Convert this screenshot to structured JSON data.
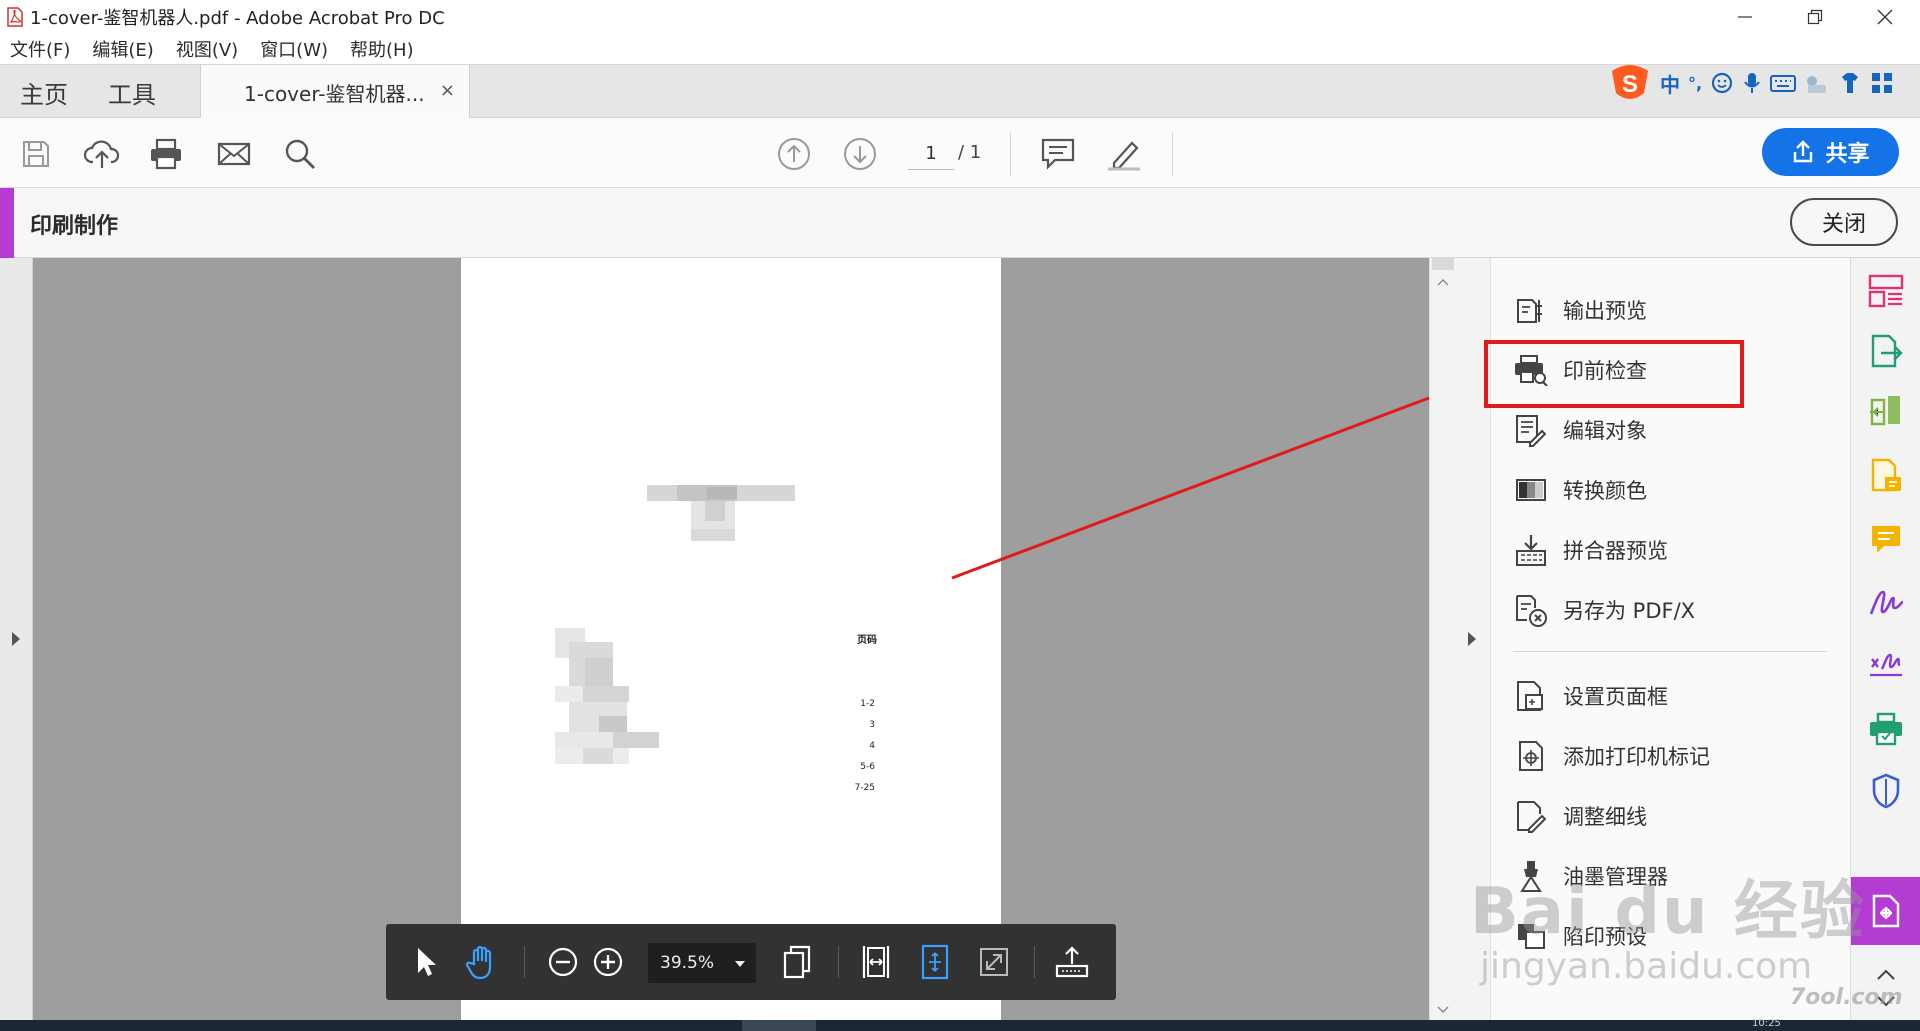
{
  "window": {
    "title": "1-cover-鉴智机器人.pdf - Adobe Acrobat Pro DC"
  },
  "menubar": {
    "items": [
      "文件(F)",
      "编辑(E)",
      "视图(V)",
      "窗口(W)",
      "帮助(H)"
    ]
  },
  "tabs": {
    "home": "主页",
    "tools": "工具",
    "document": "1-cover-鉴智机器...",
    "close_glyph": "×"
  },
  "ime": {
    "lang": "中",
    "punct": "°,"
  },
  "toolbar": {
    "page_current": "1",
    "page_total": "/ 1",
    "share_label": "共享"
  },
  "tool_panel_header": {
    "title": "印刷制作",
    "close_label": "关闭"
  },
  "document_page": {
    "toc_title": "页码",
    "toc_entries": [
      "1-2",
      "3",
      "4",
      "5-6",
      "7-25"
    ]
  },
  "float_toolbar": {
    "zoom": "39.5%"
  },
  "print_tools": {
    "group1": [
      {
        "label": "输出预览",
        "icon": "output-preview-icon"
      },
      {
        "label": "印前检查",
        "icon": "preflight-icon"
      },
      {
        "label": "编辑对象",
        "icon": "edit-object-icon"
      },
      {
        "label": "转换颜色",
        "icon": "convert-colors-icon"
      },
      {
        "label": "拼合器预览",
        "icon": "flattener-preview-icon"
      },
      {
        "label": "另存为 PDF/X",
        "icon": "save-as-pdfx-icon"
      }
    ],
    "group2": [
      {
        "label": "设置页面框",
        "icon": "set-page-boxes-icon"
      },
      {
        "label": "添加打印机标记",
        "icon": "add-printer-marks-icon"
      },
      {
        "label": "调整细线",
        "icon": "fix-hairlines-icon"
      },
      {
        "label": "油墨管理器",
        "icon": "ink-manager-icon"
      },
      {
        "label": "陷印预设",
        "icon": "trap-presets-icon"
      }
    ],
    "highlighted": "印前检查"
  },
  "watermark": {
    "main": "Bai du 经验",
    "sub": "jingyan.baidu.com",
    "corner": "7ool.com"
  },
  "taskbar": {
    "clock": "10:25"
  },
  "colors": {
    "accent_purple": "#b43cd3",
    "share_blue": "#1473e6",
    "highlight_red": "#e11b1b",
    "viewport_gray": "#9e9e9e"
  }
}
